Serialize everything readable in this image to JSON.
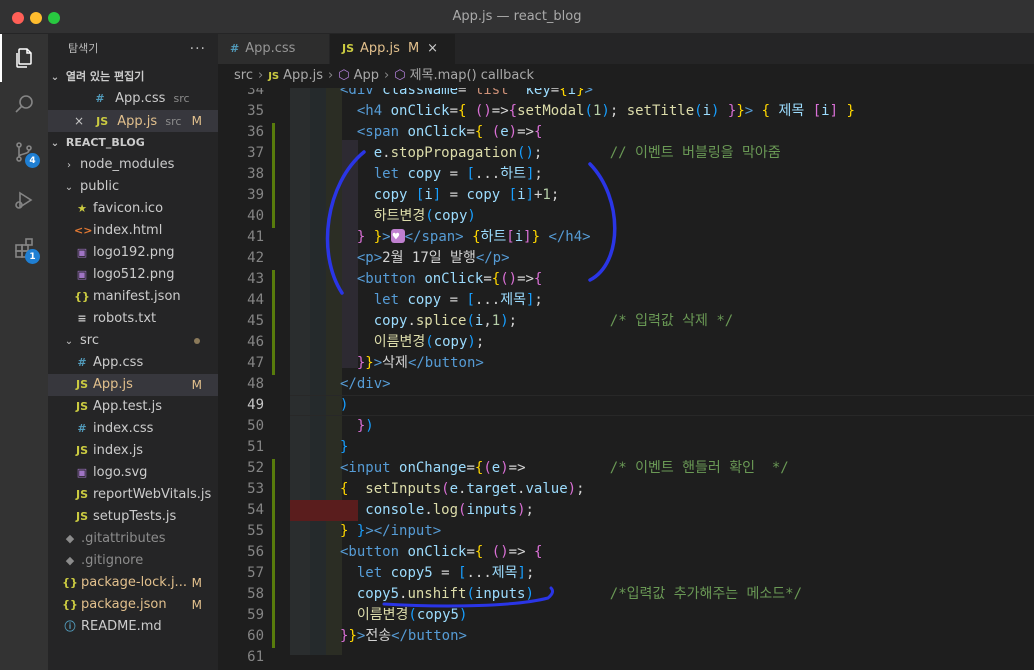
{
  "window": {
    "title": "App.js — react_blog"
  },
  "activity_bar": {
    "source_control_badge": "4",
    "extensions_badge": "1"
  },
  "explorer": {
    "header": "탐색기",
    "more": "···",
    "open_editors_label": "열려 있는 편집기",
    "open_editors": [
      {
        "name": "App.css",
        "folder": "src",
        "icon": "#"
      },
      {
        "name": "App.js",
        "folder": "src",
        "icon": "JS",
        "mark": "M",
        "close": "×"
      }
    ],
    "project_label": "REACT_BLOG",
    "tree": [
      {
        "name": "node_modules",
        "icon": ">",
        "kind": "folder-collapsed"
      },
      {
        "name": "public",
        "icon": "v",
        "kind": "folder-open"
      },
      {
        "name": "favicon.ico",
        "icon": "★",
        "kind": "file"
      },
      {
        "name": "index.html",
        "icon": "<>",
        "kind": "file"
      },
      {
        "name": "logo192.png",
        "icon": "▣",
        "kind": "file"
      },
      {
        "name": "logo512.png",
        "icon": "▣",
        "kind": "file"
      },
      {
        "name": "manifest.json",
        "icon": "{}",
        "kind": "file"
      },
      {
        "name": "robots.txt",
        "icon": "≡",
        "kind": "file"
      },
      {
        "name": "src",
        "icon": "v",
        "kind": "folder-open",
        "dot": true
      },
      {
        "name": "App.css",
        "icon": "#",
        "kind": "file"
      },
      {
        "name": "App.js",
        "icon": "JS",
        "kind": "file",
        "mark": "M"
      },
      {
        "name": "App.test.js",
        "icon": "JS",
        "kind": "file"
      },
      {
        "name": "index.css",
        "icon": "#",
        "kind": "file"
      },
      {
        "name": "index.js",
        "icon": "JS",
        "kind": "file"
      },
      {
        "name": "logo.svg",
        "icon": "▣",
        "kind": "file"
      },
      {
        "name": "reportWebVitals.js",
        "icon": "JS",
        "kind": "file"
      },
      {
        "name": "setupTests.js",
        "icon": "JS",
        "kind": "file"
      },
      {
        "name": ".gitattributes",
        "icon": "◆",
        "kind": "file"
      },
      {
        "name": ".gitignore",
        "icon": "◆",
        "kind": "file"
      },
      {
        "name": "package-lock.j...",
        "icon": "{}",
        "kind": "file",
        "mark": "M"
      },
      {
        "name": "package.json",
        "icon": "{}",
        "kind": "file",
        "mark": "M"
      },
      {
        "name": "README.md",
        "icon": "ⓘ",
        "kind": "file"
      }
    ]
  },
  "tabs": [
    {
      "name": "App.css",
      "icon": "#",
      "active": false
    },
    {
      "name": "App.js",
      "icon": "JS",
      "active": true,
      "mark": "M",
      "close": "×"
    }
  ],
  "breadcrumb": [
    "src",
    "App.js",
    "App",
    "제목.map() callback"
  ],
  "code": {
    "current_line": 49,
    "line_numbers": [
      34,
      35,
      36,
      37,
      38,
      39,
      40,
      41,
      42,
      43,
      44,
      45,
      46,
      47,
      48,
      49,
      50,
      51,
      52,
      53,
      54,
      55,
      56,
      57,
      58,
      59,
      60,
      61
    ],
    "comments": {
      "c37": "// 이벤트 버블링을 막아줌",
      "c45": "/* 입력값 삭제 */",
      "c52": "/* 이벤트 핸들러 확인  */",
      "c58": "/*입력값 추가해주는 메소드*/"
    },
    "strings": {
      "s_heart_ko": "하트",
      "s_heart_change": "하트변경",
      "s_title_ko": "제목",
      "s_date": "2월 17일 발행",
      "s_name_change": "이름변경",
      "s_delete": "삭제",
      "s_send": "전송"
    }
  }
}
